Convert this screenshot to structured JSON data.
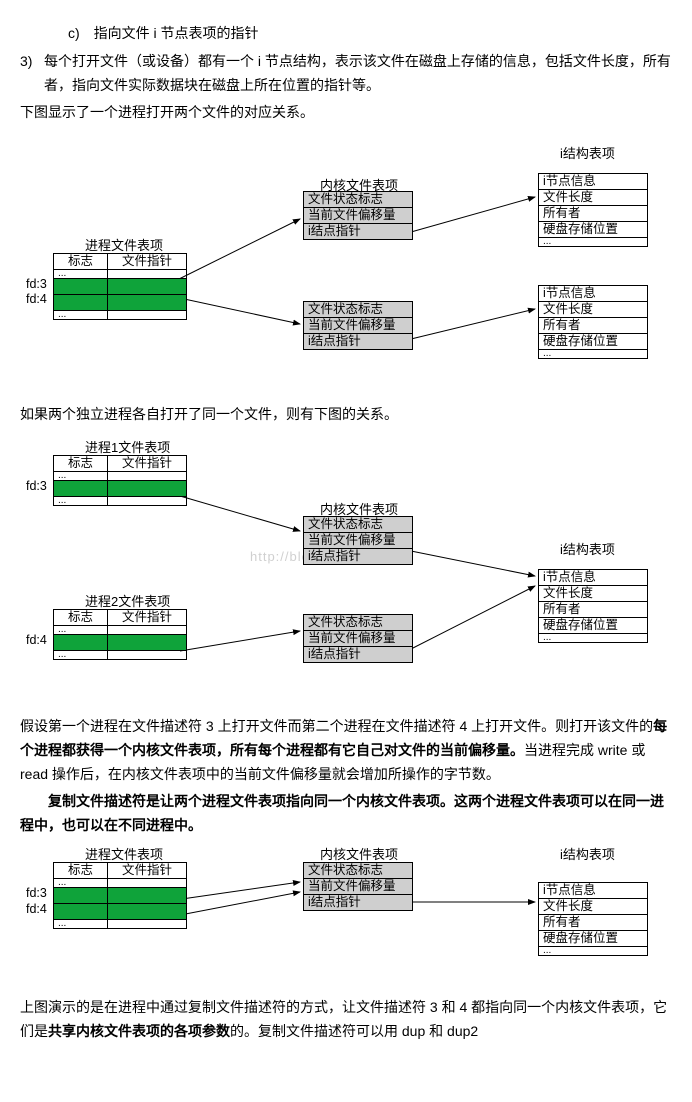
{
  "top": {
    "c": "c)　指向文件 i 节点表项的指针",
    "three": "每个打开文件（或设备）都有一个 i 节点结构，表示该文件在磁盘上存储的信息，包括文件长度，所有者，指向文件实际数据块在磁盘上所在位置的指针等。",
    "three_num": "3)",
    "below": "下图显示了一个进程打开两个文件的对应关系。"
  },
  "labels": {
    "proc_table": "进程文件表项",
    "proc1_table": "进程1文件表项",
    "proc2_table": "进程2文件表项",
    "kernel_table": "内核文件表项",
    "inode_table": "i结构表项",
    "flag": "标志",
    "fileptr": "文件指针",
    "filestatus": "文件状态标志",
    "curoffset": "当前文件偏移量",
    "inodeptr": "i结点指针",
    "inodeinfo": "i节点信息",
    "filelen": "文件长度",
    "owner": "所有者",
    "diskpos": "硬盘存储位置",
    "fd3": "fd:3",
    "fd4": "fd:4",
    "dots": "..."
  },
  "mid1": "如果两个独立进程各自打开了同一个文件，则有下图的关系。",
  "mid2_a": "假设第一个进程在文件描述符 3 上打开文件而第二个进程在文件描述符 4 上打开文件。则打开该文件的",
  "mid2_b": "每个进程都获得一个内核文件表项，所有每个进程都有它自己对文件的当前偏移量。",
  "mid2_c": "当进程完成 write 或 read 操作后，在内核文件表项中的当前文件偏移量就会增加所操作的字节数。",
  "mid3_a": "复制文件描述符是让两个进程文件表项指向同一个内核文件表项。这两个进程文件表项可以在同一进程中，也可以在不同进程中。",
  "bottom_a": "上图演示的是在进程中通过复制文件描述符的方式，让文件描述符 3 和 4 都指向同一个内核文件表项，它们是",
  "bottom_b": "共享内核文件表项的各项参数",
  "bottom_c": "的。复制文件描述符可以用 dup 和 dup2",
  "watermark": "http://blog.csdn.net/"
}
